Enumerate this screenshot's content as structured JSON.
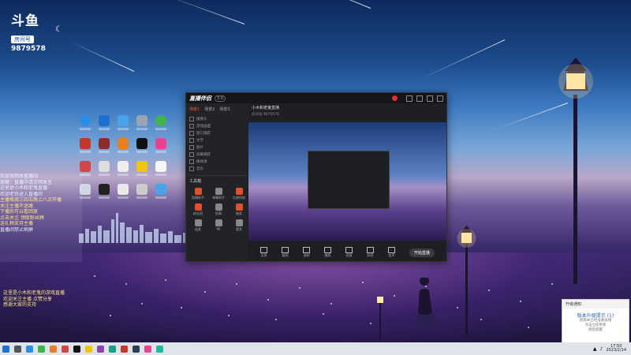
{
  "brand": {
    "logo": "斗鱼",
    "room_label": "房间号",
    "room_number": "9879578"
  },
  "chat": {
    "lines": [
      {
        "text": "欢迎来到本直播间",
        "hl": false
      },
      {
        "text": "提醒：直播中请文明发言",
        "hl": false
      },
      {
        "text": "这里是小木和老鬼直播",
        "hl": false
      },
      {
        "text": "",
        "hl": false
      },
      {
        "text": "欢迎老铁进入直播间",
        "hl": false
      },
      {
        "text": "主播每周三四五晚上八点开播",
        "hl": true
      },
      {
        "text": "关注主播不迷路",
        "hl": true
      },
      {
        "text": "下播后可以看回放",
        "hl": true
      },
      {
        "text": "点击关注 领取粉丝牌",
        "hl": true
      },
      {
        "text": "送礼物支持主播",
        "hl": true
      },
      {
        "text": "直播间禁止刷屏",
        "hl": false
      }
    ],
    "lines2": [
      "这里是小木和老鬼的游戏直播",
      "欢迎关注主播 点赞分享",
      "感谢大家的支持"
    ]
  },
  "app": {
    "logo": "直播伴侣",
    "version": "3.0",
    "tabs": [
      "场景1",
      "场景2",
      "场景3"
    ],
    "sources": [
      "摄像头",
      "游戏画面",
      "窗口捕获",
      "文字",
      "图片",
      "屏幕捕获",
      "媒体源",
      "音乐"
    ],
    "tools_title": "工具箱",
    "tools": [
      "直播助手",
      "弹幕助手",
      "礼物特效",
      "粉丝团",
      "投票",
      "抽奖",
      "连麦",
      "PK",
      "更多"
    ],
    "room_title": "小木和老鬼直播",
    "room_meta": "房间号 9879578",
    "bottom_buttons": [
      "全屏",
      "截图",
      "录制",
      "美颜",
      "滤镜",
      "贴纸",
      "变声"
    ],
    "start_label": "开始直播"
  },
  "popup": {
    "header": "升级通知",
    "title": "版本升级提示 (1)",
    "line1": "新版本已经准备就绪",
    "line2": "点击立即更新",
    "line3": "稍后提醒"
  },
  "clock": {
    "time": "17:50",
    "date": "2023/2/14"
  }
}
